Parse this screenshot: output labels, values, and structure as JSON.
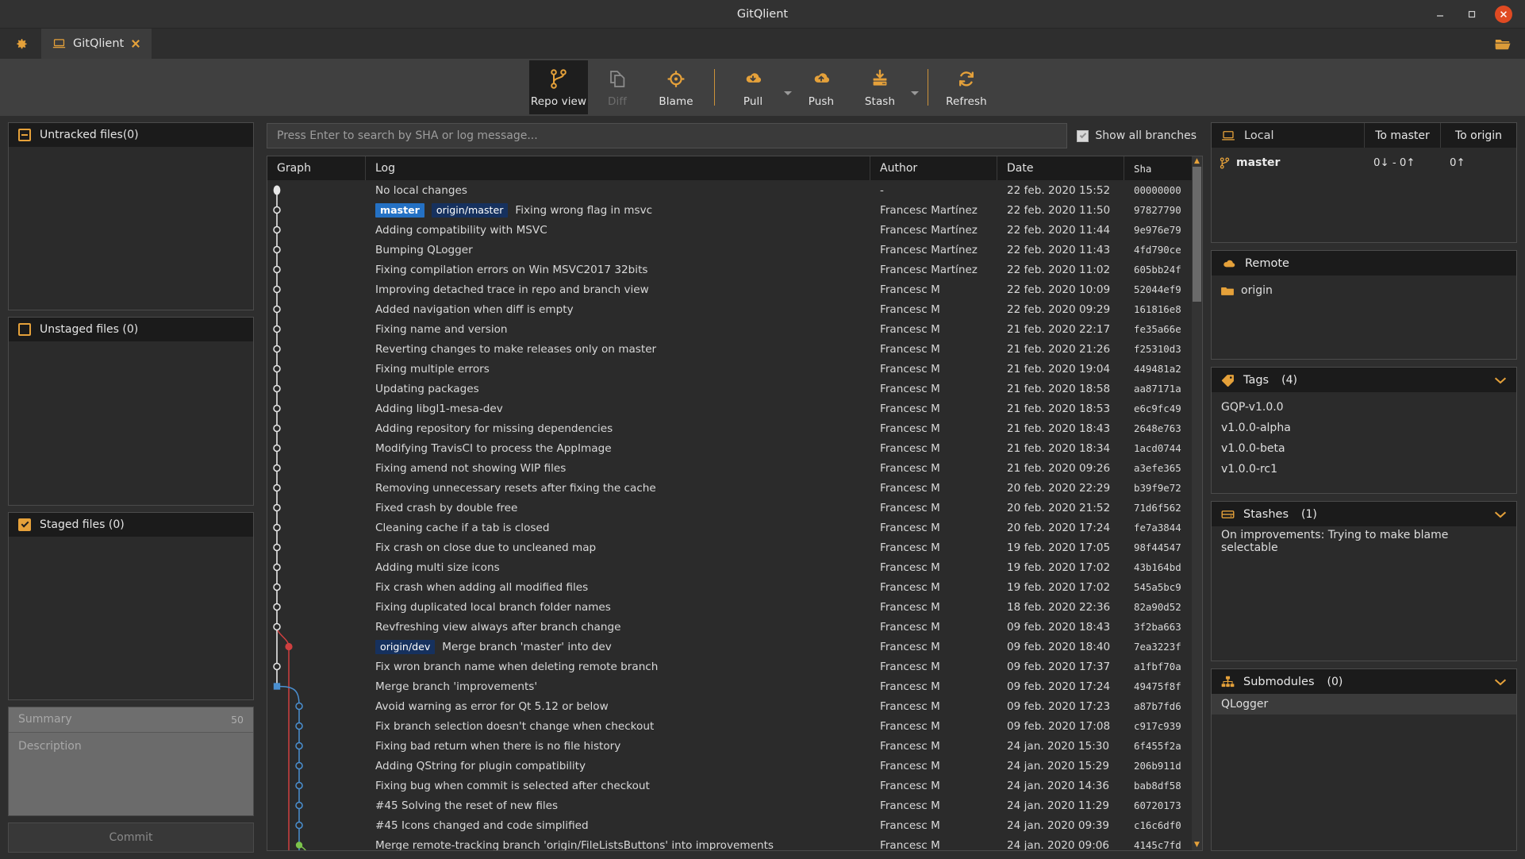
{
  "window": {
    "title": "GitQlient",
    "minimize": "‒",
    "maximize": "❐",
    "close": "✕"
  },
  "tabs": {
    "settings_icon": "gear-icon",
    "items": [
      {
        "label": "GitQlient",
        "icon": "repo-icon",
        "close": "✕",
        "active": true
      }
    ],
    "open_folder_icon": "open-folder-icon"
  },
  "toolbar": {
    "buttons": [
      {
        "label": "Repo view",
        "icon": "branch-graph-icon",
        "active": true,
        "disabled": false,
        "dropdown": false
      },
      {
        "label": "Diff",
        "icon": "files-diff-icon",
        "active": false,
        "disabled": true,
        "dropdown": false
      },
      {
        "label": "Blame",
        "icon": "target-icon",
        "active": false,
        "disabled": false,
        "dropdown": false
      },
      {
        "label": "Pull",
        "icon": "cloud-download-icon",
        "active": false,
        "disabled": false,
        "dropdown": true
      },
      {
        "label": "Push",
        "icon": "cloud-upload-icon",
        "active": false,
        "disabled": false,
        "dropdown": false
      },
      {
        "label": "Stash",
        "icon": "stash-download-icon",
        "active": false,
        "disabled": false,
        "dropdown": true
      },
      {
        "label": "Refresh",
        "icon": "refresh-icon",
        "active": false,
        "disabled": false,
        "dropdown": false
      }
    ]
  },
  "search": {
    "placeholder": "Press Enter to search by SHA or log message...",
    "value": ""
  },
  "show_all_branches": {
    "label": "Show all branches",
    "checked": true
  },
  "left_panel": {
    "untracked": {
      "title": "Untracked files(0)",
      "icon": "minus-box-icon",
      "items": []
    },
    "unstaged": {
      "title": "Unstaged files (0)",
      "icon": "empty-box-icon",
      "items": []
    },
    "staged": {
      "title": "Staged files (0)",
      "icon": "checked-box-icon",
      "items": []
    },
    "commit_form": {
      "summary_placeholder": "Summary",
      "summary_value": "",
      "summary_counter": "50",
      "description_placeholder": "Description",
      "description_value": "",
      "commit_button": "Commit"
    }
  },
  "commit_table": {
    "columns": [
      "Graph",
      "Log",
      "Author",
      "Date",
      "Sha"
    ],
    "rows": [
      {
        "log": "No local changes",
        "badges": [],
        "author": "-",
        "date": "22 feb. 2020 15:52",
        "sha": "00000000"
      },
      {
        "log": "Fixing wrong flag in msvc",
        "badges": [
          {
            "text": "master",
            "kind": "local"
          },
          {
            "text": "origin/master",
            "kind": "remote"
          }
        ],
        "author": "Francesc Martínez",
        "date": "22 feb. 2020 11:50",
        "sha": "97827790"
      },
      {
        "log": "Adding compatibility with MSVC",
        "badges": [],
        "author": "Francesc Martínez",
        "date": "22 feb. 2020 11:44",
        "sha": "9e976e79"
      },
      {
        "log": "Bumping QLogger",
        "badges": [],
        "author": "Francesc Martínez",
        "date": "22 feb. 2020 11:43",
        "sha": "4fd790ce"
      },
      {
        "log": "Fixing compilation errors on Win MSVC2017 32bits",
        "badges": [],
        "author": "Francesc Martínez",
        "date": "22 feb. 2020 11:02",
        "sha": "605bb24f"
      },
      {
        "log": "Improving detached trace in repo and branch view",
        "badges": [],
        "author": "Francesc M",
        "date": "22 feb. 2020 10:09",
        "sha": "52044ef9"
      },
      {
        "log": "Added navigation when diff is empty",
        "badges": [],
        "author": "Francesc M",
        "date": "22 feb. 2020 09:29",
        "sha": "161816e8"
      },
      {
        "log": "Fixing name and version",
        "badges": [],
        "author": "Francesc M",
        "date": "21 feb. 2020 22:17",
        "sha": "fe35a66e"
      },
      {
        "log": "Reverting changes to make releases only on master",
        "badges": [],
        "author": "Francesc M",
        "date": "21 feb. 2020 21:26",
        "sha": "f25310d3"
      },
      {
        "log": "Fixing multiple errors",
        "badges": [],
        "author": "Francesc M",
        "date": "21 feb. 2020 19:04",
        "sha": "449481a2"
      },
      {
        "log": "Updating packages",
        "badges": [],
        "author": "Francesc M",
        "date": "21 feb. 2020 18:58",
        "sha": "aa87171a"
      },
      {
        "log": "Adding libgl1-mesa-dev",
        "badges": [],
        "author": "Francesc M",
        "date": "21 feb. 2020 18:53",
        "sha": "e6c9fc49"
      },
      {
        "log": "Adding repository for missing dependencies",
        "badges": [],
        "author": "Francesc M",
        "date": "21 feb. 2020 18:43",
        "sha": "2648e763"
      },
      {
        "log": "Modifying TravisCI to process the AppImage",
        "badges": [],
        "author": "Francesc M",
        "date": "21 feb. 2020 18:34",
        "sha": "1acd0744"
      },
      {
        "log": "Fixing amend not showing WIP files",
        "badges": [],
        "author": "Francesc M",
        "date": "21 feb. 2020 09:26",
        "sha": "a3efe365"
      },
      {
        "log": "Removing unnecessary resets after fixing the cache",
        "badges": [],
        "author": "Francesc M",
        "date": "20 feb. 2020 22:29",
        "sha": "b39f9e72"
      },
      {
        "log": "Fixed crash by double free",
        "badges": [],
        "author": "Francesc M",
        "date": "20 feb. 2020 21:52",
        "sha": "71d6f562"
      },
      {
        "log": "Cleaning cache if a tab is closed",
        "badges": [],
        "author": "Francesc M",
        "date": "20 feb. 2020 17:24",
        "sha": "fe7a3844"
      },
      {
        "log": "Fix crash on close due to uncleaned map",
        "badges": [],
        "author": "Francesc M",
        "date": "19 feb. 2020 17:05",
        "sha": "98f44547"
      },
      {
        "log": "Adding multi size icons",
        "badges": [],
        "author": "Francesc M",
        "date": "19 feb. 2020 17:02",
        "sha": "43b164bd"
      },
      {
        "log": "Fix crash when adding all modified files",
        "badges": [],
        "author": "Francesc M",
        "date": "19 feb. 2020 17:02",
        "sha": "545a5bc9"
      },
      {
        "log": "Fixing duplicated local branch folder names",
        "badges": [],
        "author": "Francesc M",
        "date": "18 feb. 2020 22:36",
        "sha": "82a90d52"
      },
      {
        "log": "Revfreshing view always after branch change",
        "badges": [],
        "author": "Francesc M",
        "date": "09 feb. 2020 18:43",
        "sha": "3f2ba663"
      },
      {
        "log": "Merge branch 'master' into dev",
        "badges": [
          {
            "text": "origin/dev",
            "kind": "remote"
          }
        ],
        "author": "Francesc M",
        "date": "09 feb. 2020 18:40",
        "sha": "7ea3223f"
      },
      {
        "log": "Fix wron branch name when deleting remote branch",
        "badges": [],
        "author": "Francesc M",
        "date": "09 feb. 2020 17:37",
        "sha": "a1fbf70a"
      },
      {
        "log": "Merge branch 'improvements'",
        "badges": [],
        "author": "Francesc M",
        "date": "09 feb. 2020 17:24",
        "sha": "49475f8f"
      },
      {
        "log": "Avoid warning as error for Qt 5.12 or below",
        "badges": [],
        "author": "Francesc M",
        "date": "09 feb. 2020 17:23",
        "sha": "a87b7fd6"
      },
      {
        "log": "Fix branch selection doesn't change when checkout",
        "badges": [],
        "author": "Francesc M",
        "date": "09 feb. 2020 17:08",
        "sha": "c917c939"
      },
      {
        "log": "Fixing bad return when there is no file history",
        "badges": [],
        "author": "Francesc M",
        "date": "24 jan. 2020 15:30",
        "sha": "6f455f2a"
      },
      {
        "log": "Adding QString for plugin compatibility",
        "badges": [],
        "author": "Francesc M",
        "date": "24 jan. 2020 15:29",
        "sha": "206b911d"
      },
      {
        "log": "Fixing bug when commit is selected after checkout",
        "badges": [],
        "author": "Francesc M",
        "date": "24 jan. 2020 14:36",
        "sha": "bab8df58"
      },
      {
        "log": "#45 Solving the reset of new files",
        "badges": [],
        "author": "Francesc M",
        "date": "24 jan. 2020 11:29",
        "sha": "60720173"
      },
      {
        "log": "#45 Icons changed and code simplified",
        "badges": [],
        "author": "Francesc M",
        "date": "24 jan. 2020 09:39",
        "sha": "c16c6df0"
      },
      {
        "log": "Merge remote-tracking branch 'origin/FileListsButtons' into improvements",
        "badges": [],
        "author": "Francesc M",
        "date": "24 jan. 2020 09:06",
        "sha": "4145c7fd"
      }
    ]
  },
  "right_panel": {
    "local": {
      "title": "Local",
      "icon": "laptop-icon",
      "col_to_master": "To master",
      "col_to_origin": "To origin",
      "branches": [
        {
          "name": "master",
          "icon": "branch-icon",
          "to_master": "0↓ - 0↑",
          "to_origin": "0↑"
        }
      ]
    },
    "remote": {
      "title": "Remote",
      "icon": "cloud-icon",
      "items": [
        {
          "name": "origin",
          "icon": "folder-icon"
        }
      ]
    },
    "tags": {
      "title": "Tags",
      "count": "(4)",
      "icon": "tag-icon",
      "chevron": "chevron-down-icon",
      "items": [
        "GQP-v1.0.0",
        "v1.0.0-alpha",
        "v1.0.0-beta",
        "v1.0.0-rc1"
      ]
    },
    "stashes": {
      "title": "Stashes",
      "count": "(1)",
      "icon": "stash-icon",
      "chevron": "chevron-down-icon",
      "items": [
        "On improvements: Trying to make blame selectable"
      ]
    },
    "submodules": {
      "title": "Submodules",
      "count": "(0)",
      "icon": "sitemap-icon",
      "chevron": "chevron-down-icon",
      "items": [
        "QLogger"
      ]
    }
  },
  "colors": {
    "accent": "#e5a13a",
    "badge_local": "#2471c4",
    "badge_remote": "#16315e",
    "graph_master": "#e8e8e8",
    "graph_red": "#cf4040",
    "graph_blue": "#4a8fd0",
    "graph_green": "#7cc44b",
    "close_button": "#e04a22"
  }
}
